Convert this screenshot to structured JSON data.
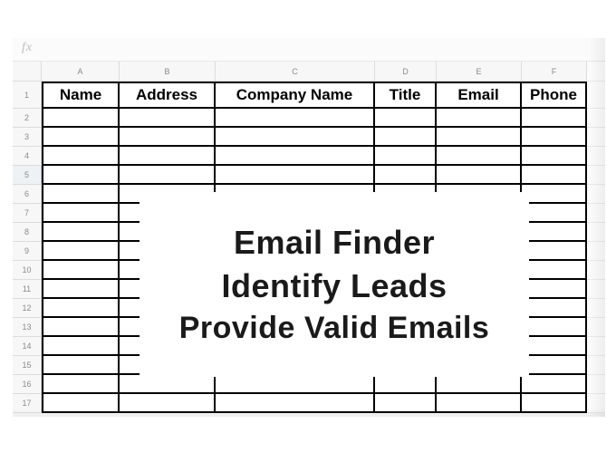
{
  "formula_bar": {
    "fx_label": "fx"
  },
  "columns": {
    "A": "A",
    "B": "B",
    "C": "C",
    "D": "D",
    "E": "E",
    "F": "F"
  },
  "row_numbers": [
    "1",
    "2",
    "3",
    "4",
    "5",
    "6",
    "7",
    "8",
    "9",
    "10",
    "11",
    "12",
    "13",
    "14",
    "15",
    "16",
    "17"
  ],
  "headers": {
    "name": "Name",
    "address": "Address",
    "company": "Company Name",
    "title": "Title",
    "email": "Email",
    "phone": "Phone"
  },
  "overlay": {
    "line1": "Email Finder",
    "line2": "Identify Leads",
    "line3": "Provide Valid Emails"
  }
}
